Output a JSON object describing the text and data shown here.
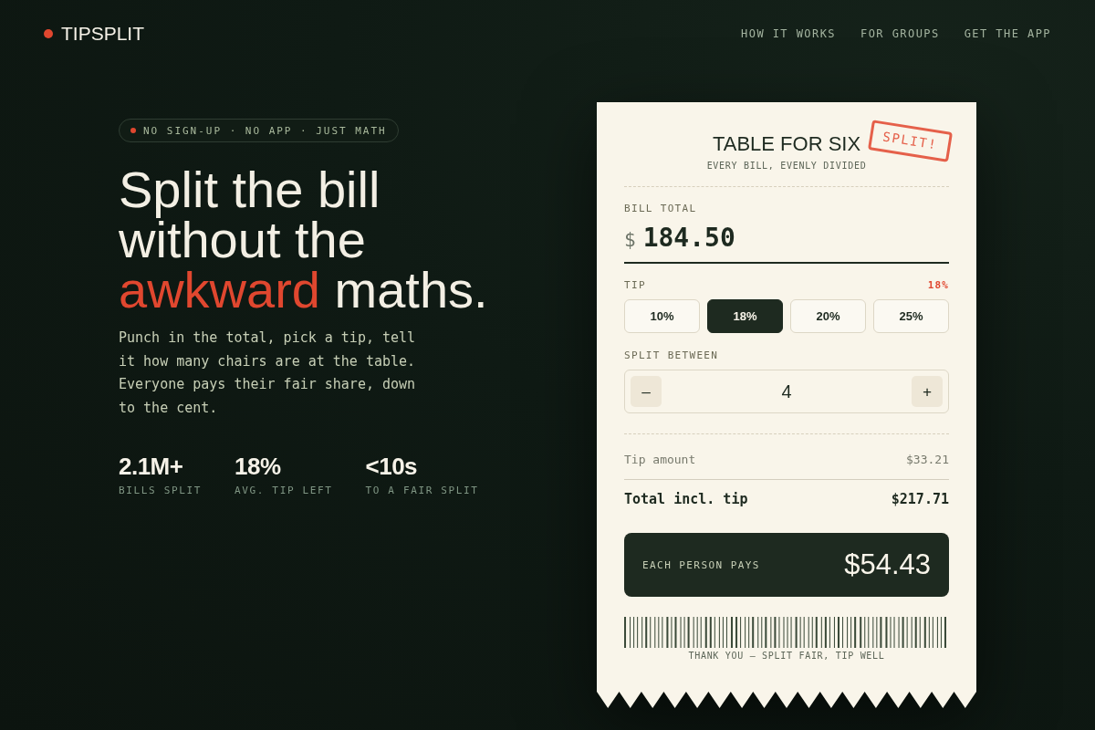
{
  "header": {
    "brand": "TIPSPLIT",
    "nav": [
      {
        "label": "HOW IT WORKS"
      },
      {
        "label": "FOR GROUPS"
      },
      {
        "label": "GET THE APP"
      }
    ]
  },
  "hero": {
    "badge": "NO SIGN-UP · NO APP · JUST MATH",
    "headline": {
      "before": "Split the bill without the",
      "highlight": "awkward",
      "after": "maths."
    },
    "lede": "Punch in the total, pick a tip, tell it how many chairs are at the table. Everyone pays their fair share, down to the cent.",
    "stats": [
      {
        "value": "2.1M+",
        "label": "BILLS SPLIT"
      },
      {
        "value": "18%",
        "label": "AVG. TIP LEFT"
      },
      {
        "value": "<10s",
        "label": "TO A FAIR SPLIT"
      }
    ]
  },
  "receipt": {
    "title": "TABLE FOR SIX",
    "subtitle": "EVERY BILL, EVENLY DIVIDED",
    "stamp": "SPLIT!",
    "bill_total": {
      "label": "BILL TOTAL",
      "currency": "$",
      "value": "184.50"
    },
    "tip": {
      "label": "TIP",
      "current": "18%",
      "options": [
        {
          "label": "10%",
          "selected": false
        },
        {
          "label": "18%",
          "selected": true
        },
        {
          "label": "20%",
          "selected": false
        },
        {
          "label": "25%",
          "selected": false
        }
      ]
    },
    "split": {
      "label": "SPLIT BETWEEN",
      "decrement": "–",
      "value": "4",
      "increment": "+"
    },
    "lines": [
      {
        "kind": "subtotal",
        "label": "Tip amount",
        "value": "$33.21"
      },
      {
        "kind": "total",
        "label": "Total incl. tip",
        "value": "$217.71"
      }
    ],
    "each": {
      "label": "EACH PERSON PAYS",
      "amount": "$54.43"
    },
    "footer": "THANK YOU — SPLIT FAIR, TIP WELL"
  }
}
